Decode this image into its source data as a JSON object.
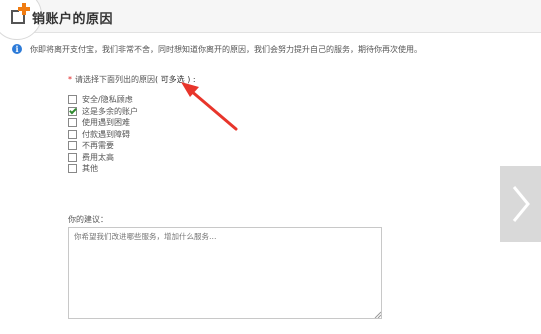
{
  "header": {
    "title": "销账户的原因"
  },
  "notice": {
    "text": "你即将离开支付宝，我们非常不舍，同时想知道你离开的原因，我们会努力提升自己的服务，期待你再次使用。"
  },
  "form": {
    "required_mark": "*",
    "prompt": "请选择下面列出的原因",
    "prompt_multi": "( 可多选 ) :",
    "options": [
      {
        "label": "安全/隐私顾虑",
        "checked": false
      },
      {
        "label": "这是多余的账户",
        "checked": true
      },
      {
        "label": "使用遇到困难",
        "checked": false
      },
      {
        "label": "付款遇到障碍",
        "checked": false
      },
      {
        "label": "不再需要",
        "checked": false
      },
      {
        "label": "费用太高",
        "checked": false
      },
      {
        "label": "其他",
        "checked": false
      }
    ],
    "suggestion_label": "你的建议：",
    "suggestion_placeholder": "你希望我们改进哪些服务，增加什么服务…"
  },
  "colors": {
    "accent_red": "#e8352b",
    "info_blue": "#2d7bd8",
    "logo_orange": "#f07c11"
  },
  "icons": {
    "logo": "add-account-icon",
    "info": "info-icon",
    "next": "chevron-right-icon"
  }
}
